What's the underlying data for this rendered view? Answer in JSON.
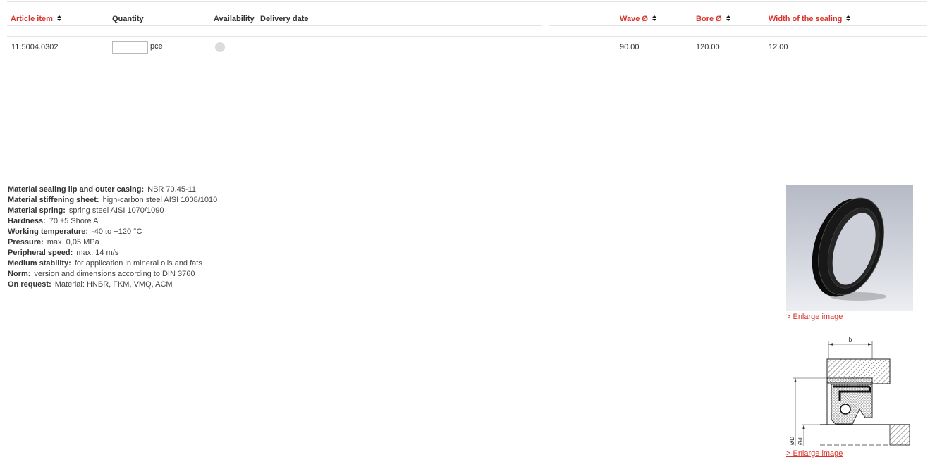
{
  "table": {
    "headers": {
      "article_item": "Article item",
      "quantity": "Quantity",
      "availability": "Availability",
      "delivery_date": "Delivery date",
      "wave": "Wave Ø",
      "bore": "Bore Ø",
      "width": "Width of the sealing"
    },
    "rows": [
      {
        "article_item": "11.5004.0302",
        "quantity": "",
        "unit": "pce",
        "availability_color": "#dcdcdc",
        "wave": "90.00",
        "bore": "120.00",
        "width": "12.00"
      }
    ]
  },
  "specs": [
    {
      "label": "Material sealing lip and outer casing:",
      "value": "NBR 70.45-11"
    },
    {
      "label": "Material stiffening sheet:",
      "value": "high-carbon steel AISI 1008/1010"
    },
    {
      "label": "Material spring:",
      "value": "spring steel AISI 1070/1090"
    },
    {
      "label": "Hardness:",
      "value": "70 ±5 Shore A"
    },
    {
      "label": "Working temperature:",
      "value": "-40 to +120 °C"
    },
    {
      "label": "Pressure:",
      "value": "max. 0,05 MPa"
    },
    {
      "label": "Peripheral speed:",
      "value": "max. 14 m/s"
    },
    {
      "label": "Medium stability:",
      "value": "for application in mineral oils and fats"
    },
    {
      "label": "Norm:",
      "value": "version and dimensions according to DIN 3760"
    },
    {
      "label": "On request:",
      "value": "Material: HNBR, FKM, VMQ, ACM"
    }
  ],
  "media": {
    "photo_link": "> Enlarge image",
    "drawing_link": "> Enlarge image",
    "drawing_labels": {
      "width_symbol": "b",
      "outer_diameter": "ØD",
      "inner_diameter": "Ød"
    }
  },
  "icons": {
    "sort": "sort-icon",
    "availability": "status-dot-icon"
  },
  "colors": {
    "accent": "#d8352d",
    "text": "#333333",
    "rule": "#e4e4e4",
    "availability_unknown": "#dcdcdc"
  }
}
